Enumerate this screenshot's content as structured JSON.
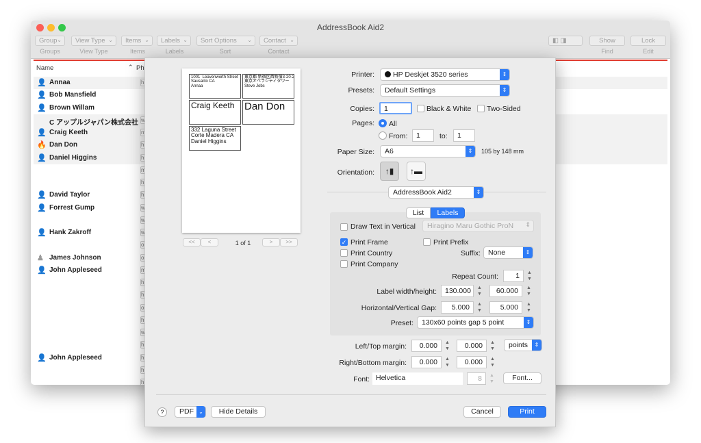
{
  "window": {
    "title": "AddressBook Aid2"
  },
  "toolbar": {
    "group": "Group",
    "view_type": "View Type",
    "items": "Items",
    "labels": "Labels",
    "sort_options": "Sort Options",
    "contact": "Contact",
    "show": "Show",
    "lock": "Lock",
    "captions": {
      "group": "Groups",
      "view_type": "View Type",
      "items": "Items",
      "labels": "Labels",
      "sort": "Sort",
      "contact": "Contact",
      "find": "Find",
      "edit": "Edit"
    }
  },
  "list": {
    "header_name": "Name",
    "header_phone": "Pho",
    "rows": [
      {
        "name": "Annaa",
        "tag": "h"
      },
      {
        "name": "Bob Mansfield",
        "tag": ""
      },
      {
        "name": "Brown Willam",
        "tag": ""
      },
      {
        "name": "C アップルジャパン株式会社",
        "tag": "w"
      },
      {
        "name": "Craig Keeth",
        "tag": "m"
      },
      {
        "name": "Dan Don",
        "tag": "h"
      },
      {
        "name": "Daniel Higgins",
        "tag": "h"
      },
      {
        "name": "",
        "tag": "m"
      },
      {
        "name": "",
        "tag": "h"
      },
      {
        "name": "David Taylor",
        "tag": "h"
      },
      {
        "name": "Forrest Gump",
        "tag": "w"
      },
      {
        "name": "",
        "tag": "w"
      },
      {
        "name": "Hank Zakroff",
        "tag": "w"
      },
      {
        "name": "",
        "tag": "o"
      },
      {
        "name": "James Johnson",
        "tag": "o"
      },
      {
        "name": "John Appleseed",
        "tag": "m"
      },
      {
        "name": "",
        "tag": "h"
      },
      {
        "name": "",
        "tag": "h"
      },
      {
        "name": "",
        "tag": "o"
      },
      {
        "name": "",
        "tag": "h"
      },
      {
        "name": "",
        "tag": "w"
      },
      {
        "name": "",
        "tag": "h"
      },
      {
        "name": "John Appleseed",
        "tag": "h"
      },
      {
        "name": "",
        "tag": "h"
      },
      {
        "name": "",
        "tag": "h"
      }
    ]
  },
  "preview": {
    "labels": [
      {
        "text": "1001  Leavenworth Street\nSausalito CA\nAnnaa",
        "size": "small"
      },
      {
        "text": "東京都 新宿区西新宿3-20-2\n東京オペラシティタワー\nSteve Jobs",
        "size": "small"
      },
      {
        "text": "Craig Keeth",
        "size": "big"
      },
      {
        "text": "Dan Don",
        "size": "big"
      },
      {
        "text": "332 Laguna Street\nCorte Madera CA\nDaniel Higgins",
        "size": "mid"
      }
    ],
    "page_indicator": "1 of 1",
    "first": "<<",
    "prev": "<",
    "next": ">",
    "last": ">>"
  },
  "print": {
    "printer_label": "Printer:",
    "printer": "HP Deskjet 3520 series",
    "presets_label": "Presets:",
    "presets": "Default Settings",
    "copies_label": "Copies:",
    "copies": "1",
    "bw": "Black & White",
    "two_sided": "Two-Sided",
    "pages_label": "Pages:",
    "all": "All",
    "from": "From:",
    "from_val": "1",
    "to": "to:",
    "to_val": "1",
    "paper_label": "Paper Size:",
    "paper": "A6",
    "paper_dim": "105 by 148 mm",
    "orientation_label": "Orientation:",
    "section": "AddressBook Aid2"
  },
  "tabs": {
    "list": "List",
    "labels": "Labels"
  },
  "labels_panel": {
    "draw_vertical": "Draw Text in Vertical",
    "vertical_font": "Hiragino Maru Gothic ProN",
    "print_frame": "Print Frame",
    "print_prefix": "Print Prefix",
    "print_country": "Print Country",
    "suffix_label": "Suffix:",
    "suffix": "None",
    "print_company": "Print Company",
    "repeat_label": "Repeat Count:",
    "repeat": "1",
    "wh_label": "Label width/height:",
    "width": "130.000",
    "height": "60.000",
    "gap_label": "Horizontal/Vertical Gap:",
    "hgap": "5.000",
    "vgap": "5.000",
    "preset_label": "Preset:",
    "preset": "130x60 points gap 5 point"
  },
  "margins": {
    "lt_label": "Left/Top margin:",
    "left": "0.000",
    "top": "0.000",
    "unit": "points",
    "rb_label": "Right/Bottom margin:",
    "right": "0.000",
    "bottom": "0.000",
    "font_label": "Font:",
    "font": "Helvetica",
    "font_size": "8",
    "font_btn": "Font..."
  },
  "footer": {
    "help": "?",
    "pdf": "PDF",
    "hide_details": "Hide Details",
    "cancel": "Cancel",
    "print": "Print"
  },
  "colors": {
    "accent": "#2f7cf6",
    "close": "#fc5f57",
    "minimize": "#fdbc2e",
    "zoom": "#34c84a",
    "highlight": "#e03a2e"
  }
}
